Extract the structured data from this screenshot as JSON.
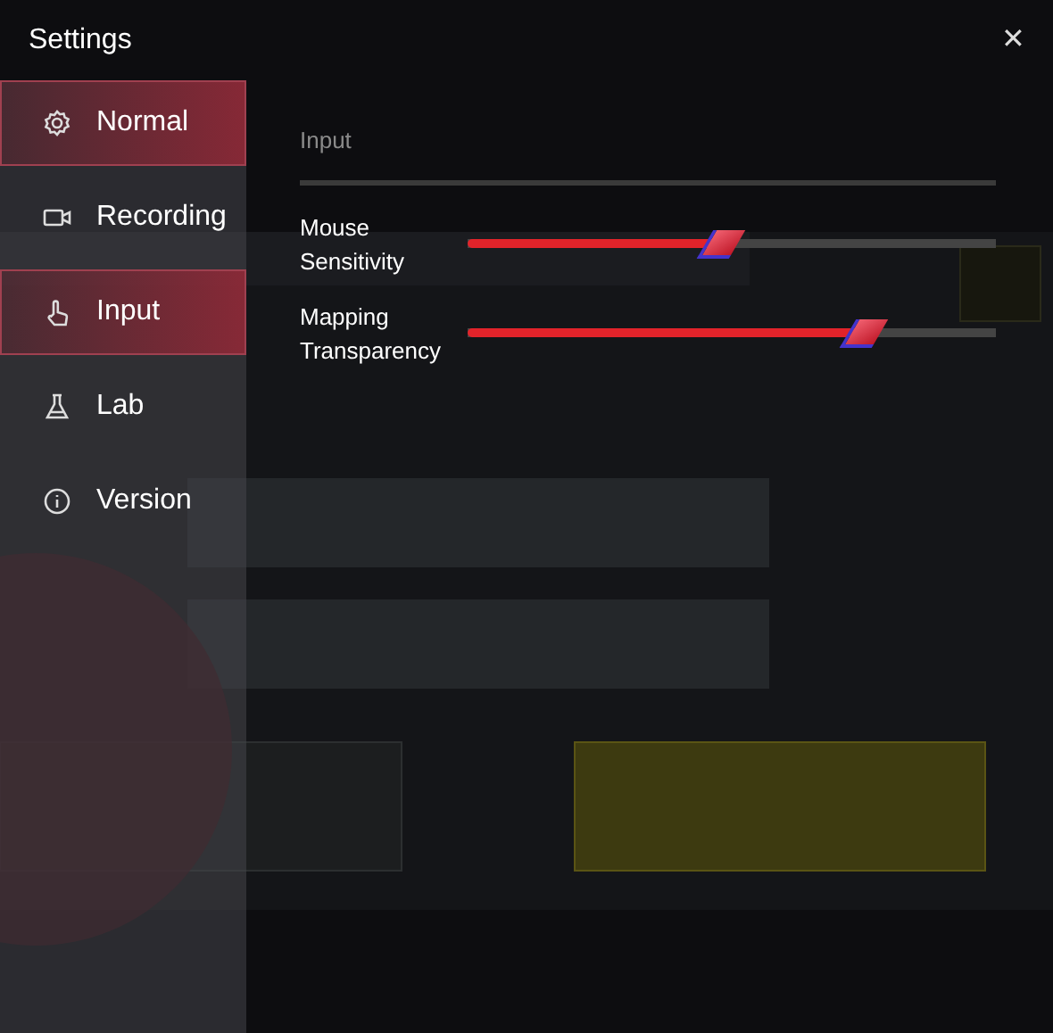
{
  "window": {
    "title": "Settings",
    "close": "✕"
  },
  "sidebar": {
    "items": [
      {
        "label": "Normal",
        "selected": true
      },
      {
        "label": "Recording",
        "selected": false
      },
      {
        "label": "Input",
        "selected": true
      },
      {
        "label": "Lab",
        "selected": false
      },
      {
        "label": "Version",
        "selected": false
      }
    ]
  },
  "section": {
    "title": "Input"
  },
  "sliders": [
    {
      "label": "Mouse Sensitivity",
      "level": 0.48
    },
    {
      "label": "Mapping Transparency",
      "level": 0.75
    }
  ]
}
